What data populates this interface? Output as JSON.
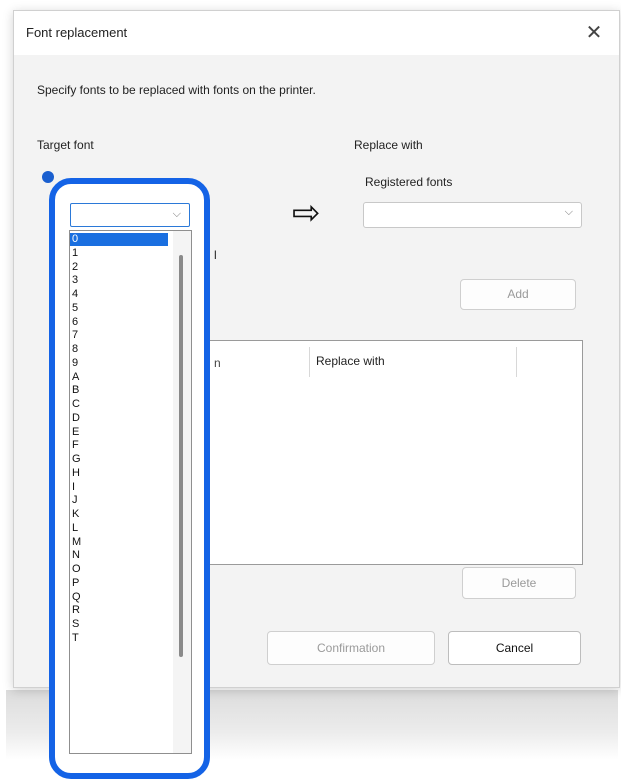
{
  "dialog": {
    "title": "Font replacement",
    "close_glyph": "✕",
    "description": "Specify fonts to be replaced with fonts on the printer.",
    "target_font_label": "Target font",
    "replace_with_label": "Replace with",
    "registered_fonts_label": "Registered fonts",
    "registered_fonts_value": "",
    "arrow_glyph": "⇨",
    "add_button": "Add",
    "list_header_replace_with": "Replace with",
    "delete_button": "Delete",
    "confirmation_button": "Confirmation",
    "cancel_button": "Cancel",
    "clipped_label_1": "l",
    "clipped_label_2": "N",
    "clipped_label_3": "n"
  },
  "target_font_dropdown": {
    "value": "",
    "options": [
      "0",
      "1",
      "2",
      "3",
      "4",
      "5",
      "6",
      "7",
      "8",
      "9",
      "A",
      "B",
      "C",
      "D",
      "E",
      "F",
      "G",
      "H",
      "I",
      "J",
      "K",
      "L",
      "M",
      "N",
      "O",
      "P",
      "Q",
      "R",
      "S",
      "T"
    ],
    "selected_index": 0
  },
  "colors": {
    "highlight": "#1463e6",
    "selection": "#1a6fe0",
    "dialog_bg": "#f3f3f3"
  }
}
